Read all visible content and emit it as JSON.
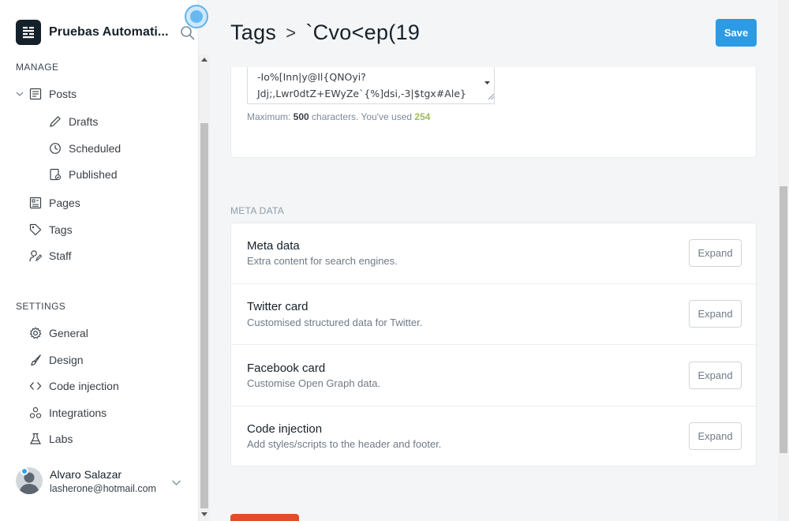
{
  "sidebar": {
    "brand_title": "Pruebas Automati...",
    "manage_title": "MANAGE",
    "settings_title": "SETTINGS",
    "manage_items": [
      {
        "label": "Posts",
        "icon": "posts-icon"
      },
      {
        "label": "Drafts",
        "icon": "pencil-icon"
      },
      {
        "label": "Scheduled",
        "icon": "clock-icon"
      },
      {
        "label": "Published",
        "icon": "published-icon"
      },
      {
        "label": "Pages",
        "icon": "pages-icon"
      },
      {
        "label": "Tags",
        "icon": "tag-icon"
      },
      {
        "label": "Staff",
        "icon": "staff-icon"
      }
    ],
    "settings_items": [
      {
        "label": "General",
        "icon": "gear-icon"
      },
      {
        "label": "Design",
        "icon": "brush-icon"
      },
      {
        "label": "Code injection",
        "icon": "code-icon"
      },
      {
        "label": "Integrations",
        "icon": "integrations-icon"
      },
      {
        "label": "Labs",
        "icon": "flask-icon"
      }
    ],
    "user": {
      "name": "Alvaro Salazar",
      "email": "lasherone@hotmail.com"
    }
  },
  "header": {
    "breadcrumb_root": "Tags",
    "breadcrumb_sep": ">",
    "breadcrumb_current": "`Cvo<ep(19",
    "save_label": "Save"
  },
  "description": {
    "lines": [
      "-Io%[Inn|y@Il{QNOyi?",
      "Jdj;,Lwr0dtZ+EWyZe`{%]dsi,-3|$tgx#Ale}"
    ],
    "counter_prefix": "Maximum: ",
    "counter_max": "500",
    "counter_mid": " characters. You've used ",
    "counter_used": "254",
    "used_color": "#9fbb58"
  },
  "meta": {
    "section_label": "META DATA",
    "rows": [
      {
        "title": "Meta data",
        "desc": "Extra content for search engines.",
        "button": "Expand"
      },
      {
        "title": "Twitter card",
        "desc": "Customised structured data for Twitter.",
        "button": "Expand"
      },
      {
        "title": "Facebook card",
        "desc": "Customise Open Graph data.",
        "button": "Expand"
      },
      {
        "title": "Code injection",
        "desc": "Add styles/scripts to the header and footer.",
        "button": "Expand"
      }
    ]
  },
  "colors": {
    "accent": "#2b9be6",
    "danger": "#e04e26"
  }
}
